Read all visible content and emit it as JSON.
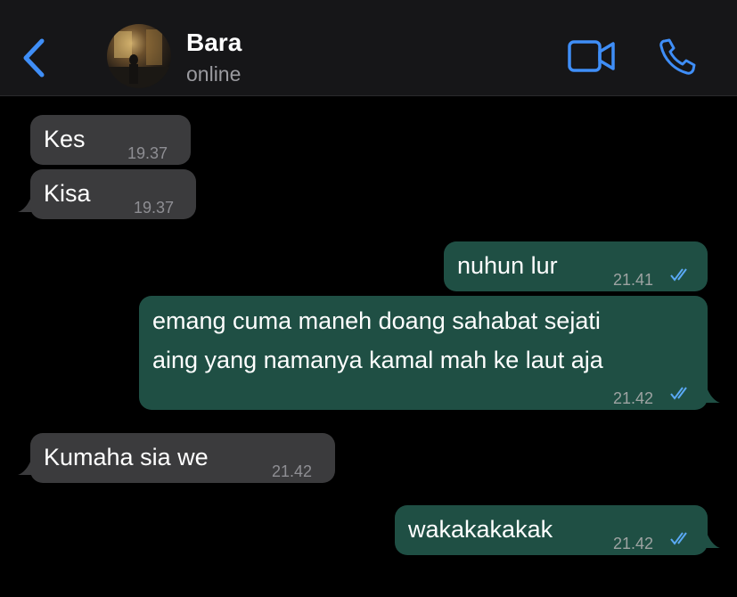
{
  "header": {
    "contact_name": "Bara",
    "status": "online",
    "back_icon": "chevron-left-icon",
    "video_icon": "video-camera-icon",
    "call_icon": "phone-icon"
  },
  "messages": [
    {
      "direction": "incoming",
      "text": "Kes",
      "time": "19.37"
    },
    {
      "direction": "incoming",
      "text": "Kisa",
      "time": "19.37"
    },
    {
      "direction": "outgoing",
      "text": "nuhun lur",
      "time": "21.41",
      "status": "read"
    },
    {
      "direction": "outgoing",
      "lines": [
        "emang cuma maneh doang sahabat sejati",
        "aing yang namanya kamal mah ke laut aja"
      ],
      "time": "21.42",
      "status": "read"
    },
    {
      "direction": "incoming",
      "text": "Kumaha sia we",
      "time": "21.42"
    },
    {
      "direction": "outgoing",
      "text": "wakakakakak",
      "time": "21.42",
      "status": "read"
    }
  ],
  "colors": {
    "background": "#000000",
    "header": "#161618",
    "accent": "#3f8ef7",
    "incoming_bubble": "#3b3b3d",
    "outgoing_bubble": "#1f4f44",
    "read_ticks": "#5aa9f5"
  }
}
